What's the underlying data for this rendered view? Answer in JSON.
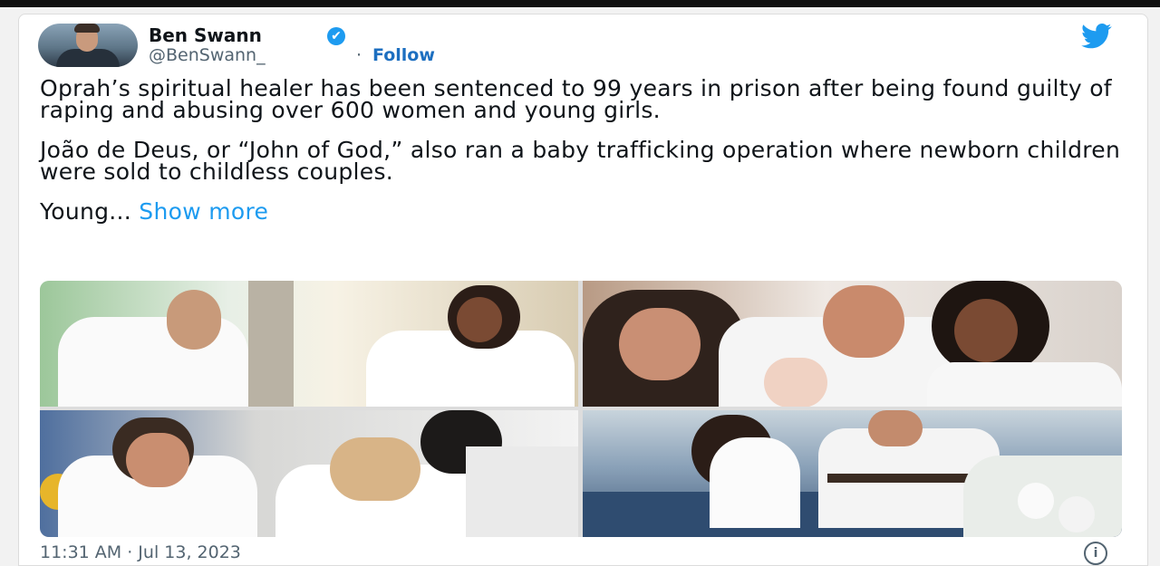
{
  "tweet": {
    "author_name": "Ben Swann",
    "handle": "@BenSwann_",
    "separator": "·",
    "follow_label": "Follow",
    "paragraphs": [
      "Oprah’s spiritual healer has been sentenced to 99 years in prison after being found guilty of raping and abusing over 600 women and young girls.",
      "João de Deus, or “John of God,” also ran a baby trafficking operation where newborn children were sold to childless couples."
    ],
    "truncated_text": "Young...",
    "show_more_label": "Show more",
    "timestamp": "11:31 AM · Jul 13, 2023",
    "verified_icon": "✔",
    "info_icon": "i"
  },
  "colors": {
    "brand": "#1d9bf0",
    "follow": "#1d6fc0",
    "text": "#0f1419",
    "muted": "#536471"
  },
  "icons": {
    "logo": "twitter-bird-icon",
    "verified": "verified-badge-icon",
    "info": "info-icon"
  }
}
